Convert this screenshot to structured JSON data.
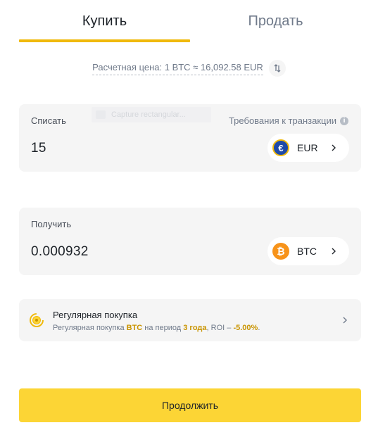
{
  "tabs": [
    {
      "label": "Купить",
      "active": true
    },
    {
      "label": "Продать",
      "active": false
    }
  ],
  "rate": {
    "text": "Расчетная цена: 1 BTC ≈ 16,092.58 EUR",
    "swap_icon": "swap-vertical-icon"
  },
  "ghost_overlay": {
    "text": "Capture rectangular..."
  },
  "spend": {
    "label": "Списать",
    "requirements_label": "Требования к транзакции",
    "amount": "15",
    "currency": "EUR",
    "currency_symbol": "€",
    "currency_color": "#1f4aa8"
  },
  "receive": {
    "label": "Получить",
    "amount": "0.000932",
    "currency": "BTC",
    "currency_symbol": "₿",
    "currency_color": "#f7931a"
  },
  "recurring": {
    "title": "Регулярная покупка",
    "subtitle_prefix": "Регулярная покупка ",
    "subtitle_coin": "BTC",
    "subtitle_mid": " на период ",
    "subtitle_years": "3 года",
    "subtitle_roi_prefix": ", ROI – ",
    "subtitle_roi": "-5.00%",
    "subtitle_end": "."
  },
  "continue_label": "Продолжить",
  "colors": {
    "accent": "#f0b90b",
    "button": "#fcd535",
    "card_bg": "#f5f5f5",
    "highlight": "#c99400"
  }
}
